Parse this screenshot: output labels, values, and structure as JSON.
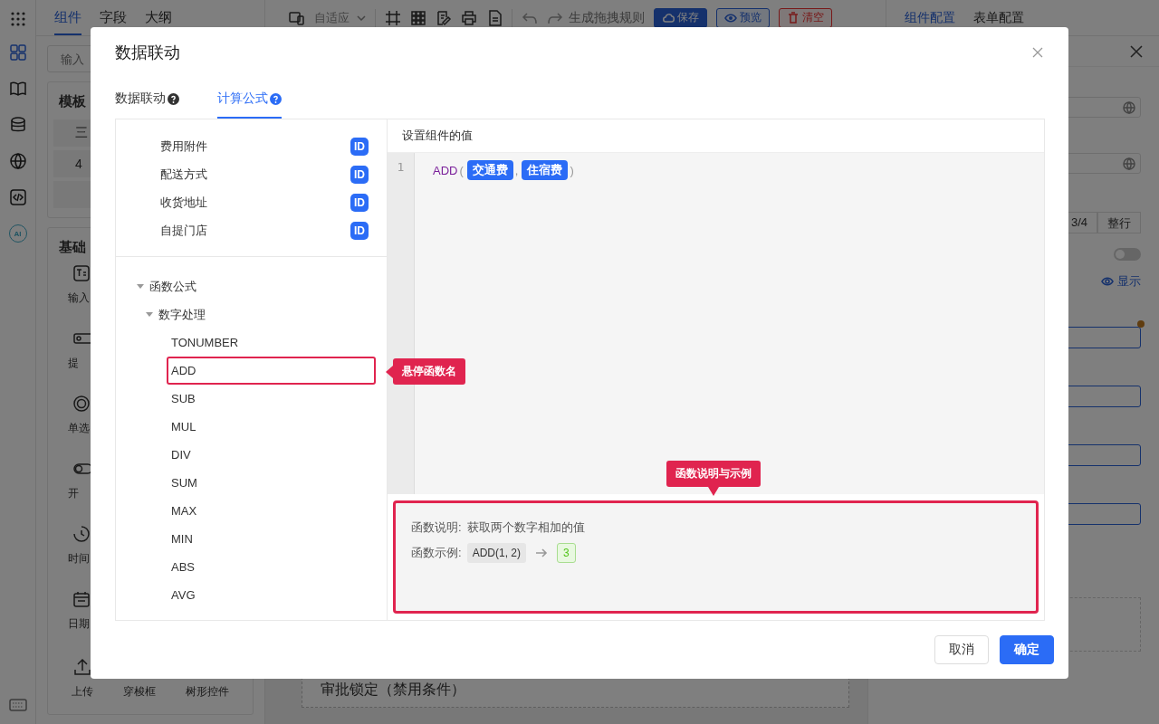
{
  "app": {
    "rail": [
      {
        "selected": true
      },
      {
        "selected": false
      },
      {
        "selected": false
      },
      {
        "selected": false
      },
      {
        "selected": false
      },
      {
        "selected": false,
        "label": "AI"
      }
    ],
    "top_tabs": [
      {
        "label": "组件",
        "selected": true
      },
      {
        "label": "字段",
        "selected": false
      },
      {
        "label": "大纲",
        "selected": false
      }
    ],
    "toolbar": {
      "layout": "自适应",
      "generate": "生成拖拽规则",
      "buttons": [
        {
          "label": "保存",
          "kind": "primary"
        },
        {
          "label": "预览",
          "kind": "preview"
        },
        {
          "label": "清空",
          "kind": "danger"
        }
      ]
    },
    "config_tabs": [
      {
        "label": "组件配置",
        "selected": true
      },
      {
        "label": "表单配置",
        "selected": false
      }
    ],
    "search": {
      "placeholder": "输入"
    },
    "templates": {
      "title": "模板",
      "items": [
        "三",
        "4"
      ]
    },
    "components": {
      "title": "基础",
      "column": [
        "输入",
        "提",
        "单选",
        "开",
        "时间",
        "日期"
      ],
      "last_row": [
        "上传",
        "穿梭框",
        "树形控件"
      ]
    },
    "canvas": {
      "item": "审批锁定（禁用条件）"
    },
    "config": {
      "span": "3/4",
      "full_row": "整行",
      "toggle_on": false,
      "show_link": "显示"
    }
  },
  "dialog": {
    "title": "数据联动",
    "tabs": [
      {
        "label": "数据联动",
        "selected": false
      },
      {
        "label": "计算公式",
        "selected": true
      }
    ],
    "fields": [
      {
        "label": "费用附件",
        "badge": "ID"
      },
      {
        "label": "配送方式",
        "badge": "ID"
      },
      {
        "label": "收货地址",
        "badge": "ID"
      },
      {
        "label": "自提门店",
        "badge": "ID"
      }
    ],
    "functions": [
      {
        "label": "函数公式",
        "expanded": true,
        "children": [
          {
            "label": "数字处理",
            "expanded": true,
            "children": [
              {
                "label": "TONUMBER",
                "highlighted": false
              },
              {
                "label": "ADD",
                "highlighted": true
              },
              {
                "label": "SUB",
                "highlighted": false
              },
              {
                "label": "MUL",
                "highlighted": false
              },
              {
                "label": "DIV",
                "highlighted": false
              },
              {
                "label": "SUM",
                "highlighted": false
              },
              {
                "label": "MAX",
                "highlighted": false
              },
              {
                "label": "MIN",
                "highlighted": false
              },
              {
                "label": "ABS",
                "highlighted": false
              },
              {
                "label": "AVG",
                "highlighted": false
              }
            ]
          }
        ]
      }
    ],
    "editor": {
      "title": "设置组件的值",
      "lines": [
        {
          "number": "1",
          "tokens": [
            {
              "kind": "fn",
              "text": "ADD"
            },
            {
              "kind": "punct",
              "text": "("
            },
            {
              "kind": "field",
              "text": "交通费"
            },
            {
              "kind": "punct",
              "text": ","
            },
            {
              "kind": "field",
              "text": "住宿费"
            },
            {
              "kind": "punct",
              "text": ")"
            }
          ]
        }
      ]
    },
    "help": {
      "highlighted": true,
      "desc_label": "函数说明:",
      "desc": "获取两个数字相加的值",
      "example_label": "函数示例:",
      "example": "ADD(1, 2)",
      "result": "3"
    },
    "annotations": [
      {
        "text": "悬停函数名",
        "kind": "left"
      },
      {
        "text": "函数说明与示例",
        "kind": "down"
      }
    ],
    "buttons": [
      {
        "label": "取消",
        "kind": "default"
      },
      {
        "label": "确定",
        "kind": "primary"
      }
    ]
  }
}
